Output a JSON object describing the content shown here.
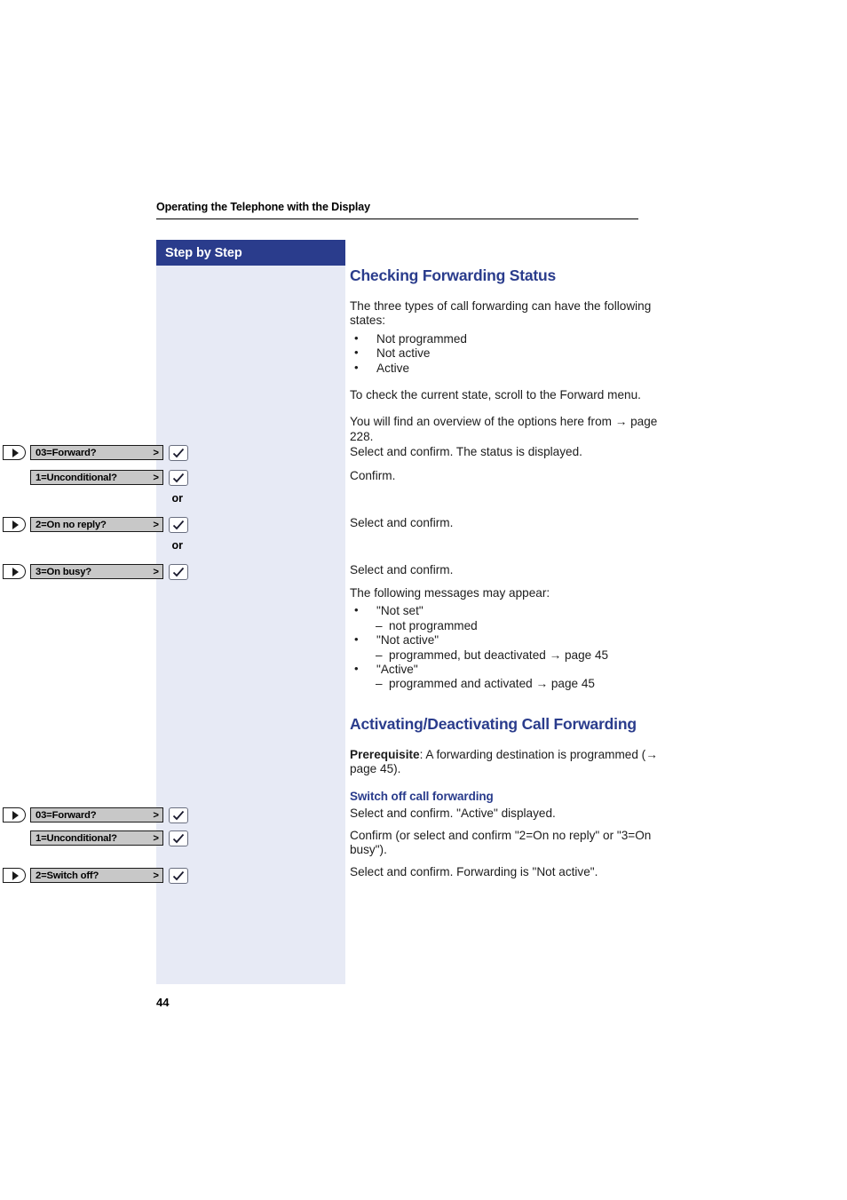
{
  "header": {
    "running_head": "Operating the Telephone with the Display"
  },
  "sidebar": {
    "title": "Step by Step",
    "or_labels": [
      "or",
      "or"
    ]
  },
  "sections": [
    {
      "title": "Checking Forwarding Status",
      "intro": "The three types of call forwarding can have the following states:",
      "states": [
        "Not programmed",
        "Not active",
        "Active"
      ],
      "check_line": "To check the current state, scroll to the Forward menu.",
      "overview_line": "You will find an overview of the options here from → page 228.",
      "messages_intro": "The following messages may appear:",
      "messages": [
        {
          "label": "\"Not set\"",
          "detail": "not programmed"
        },
        {
          "label": "\"Not active\"",
          "detail": "programmed, but deactivated → page 45"
        },
        {
          "label": "\"Active\"",
          "detail": "programmed and activated → page 45"
        }
      ]
    },
    {
      "title": "Activating/Deactivating Call Forwarding",
      "prerequisite_label": "Prerequisite",
      "prerequisite_text": ": A forwarding destination is programmed (→ page 45).",
      "subtitle": "Switch off call forwarding"
    }
  ],
  "steps_group_1": [
    {
      "nav_key": true,
      "display_label": "03=Forward?",
      "caret": ">",
      "confirm_key": true,
      "annotation": "Select and confirm. The status is displayed."
    },
    {
      "nav_key": false,
      "display_label": "1=Unconditional?",
      "caret": ">",
      "confirm_key": true,
      "annotation": "Confirm."
    },
    {
      "nav_key": true,
      "display_label": "2=On no reply?",
      "caret": ">",
      "confirm_key": true,
      "annotation": "Select and confirm."
    },
    {
      "nav_key": true,
      "display_label": "3=On busy?",
      "caret": ">",
      "confirm_key": true,
      "annotation": "Select and confirm."
    }
  ],
  "steps_group_2": [
    {
      "nav_key": true,
      "display_label": "03=Forward?",
      "caret": ">",
      "confirm_key": true,
      "annotation": "Select and confirm. \"Active\" displayed."
    },
    {
      "nav_key": false,
      "display_label": "1=Unconditional?",
      "caret": ">",
      "confirm_key": true,
      "annotation": "Confirm (or select and confirm \"2=On no reply\" or \"3=On busy\")."
    },
    {
      "nav_key": true,
      "display_label": "2=Switch off?",
      "caret": ">",
      "confirm_key": true,
      "annotation": "Select and confirm. Forwarding is \"Not active\"."
    }
  ],
  "footer": {
    "page_number": "44"
  },
  "colors": {
    "accent_navy": "#2a3c8c",
    "panel_bg": "#e7eaf5",
    "display_key_bg": "#c8c8c8"
  }
}
